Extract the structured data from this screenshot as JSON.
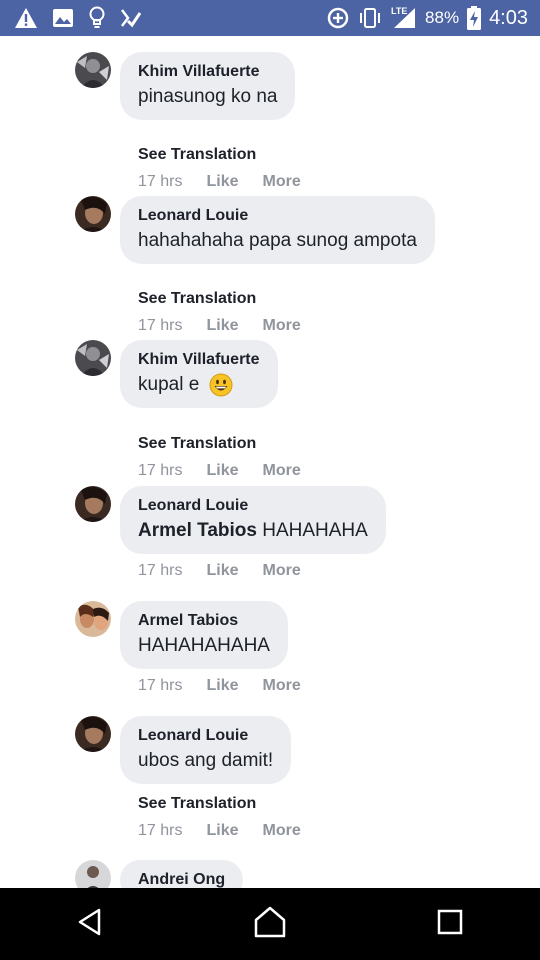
{
  "status_bar": {
    "battery_percent": "88%",
    "time": "4:03",
    "network": "LTE",
    "icons_left": [
      "warning-icon",
      "image-icon",
      "lightbulb-icon",
      "checklist-icon"
    ],
    "icons_right": [
      "data-saver-icon",
      "vibrate-icon",
      "signal-icon",
      "battery-charging-icon"
    ]
  },
  "comments": [
    {
      "author": "Khim Villafuerte",
      "text": "pinasunog ko na",
      "see_translation": "See Translation",
      "time": "17 hrs",
      "like": "Like",
      "more": "More",
      "avatar": "avatar-khim"
    },
    {
      "author": "Leonard Louie",
      "text": "hahahahaha papa sunog ampota",
      "see_translation": "See Translation",
      "time": "17 hrs",
      "like": "Like",
      "more": "More",
      "avatar": "avatar-leonard"
    },
    {
      "author": "Khim Villafuerte",
      "text": "kupal e",
      "emoji": "grinning-face-emoji",
      "see_translation": "See Translation",
      "time": "17 hrs",
      "like": "Like",
      "more": "More",
      "avatar": "avatar-khim"
    },
    {
      "author": "Leonard Louie",
      "mention": "Armel Tabios",
      "text": " HAHAHAHA",
      "time": "17 hrs",
      "like": "Like",
      "more": "More",
      "avatar": "avatar-leonard"
    },
    {
      "author": "Armel Tabios",
      "text": "HAHAHAHAHA",
      "time": "17 hrs",
      "like": "Like",
      "more": "More",
      "avatar": "avatar-armel"
    },
    {
      "author": "Leonard Louie",
      "text": "ubos ang damit!",
      "see_translation": "See Translation",
      "time": "17 hrs",
      "like": "Like",
      "more": "More",
      "avatar": "avatar-leonard"
    },
    {
      "author": "Andrei Ong",
      "avatar": "avatar-andrei"
    }
  ],
  "nav": {
    "back": "back-icon",
    "home": "home-icon",
    "recents": "recents-icon"
  }
}
